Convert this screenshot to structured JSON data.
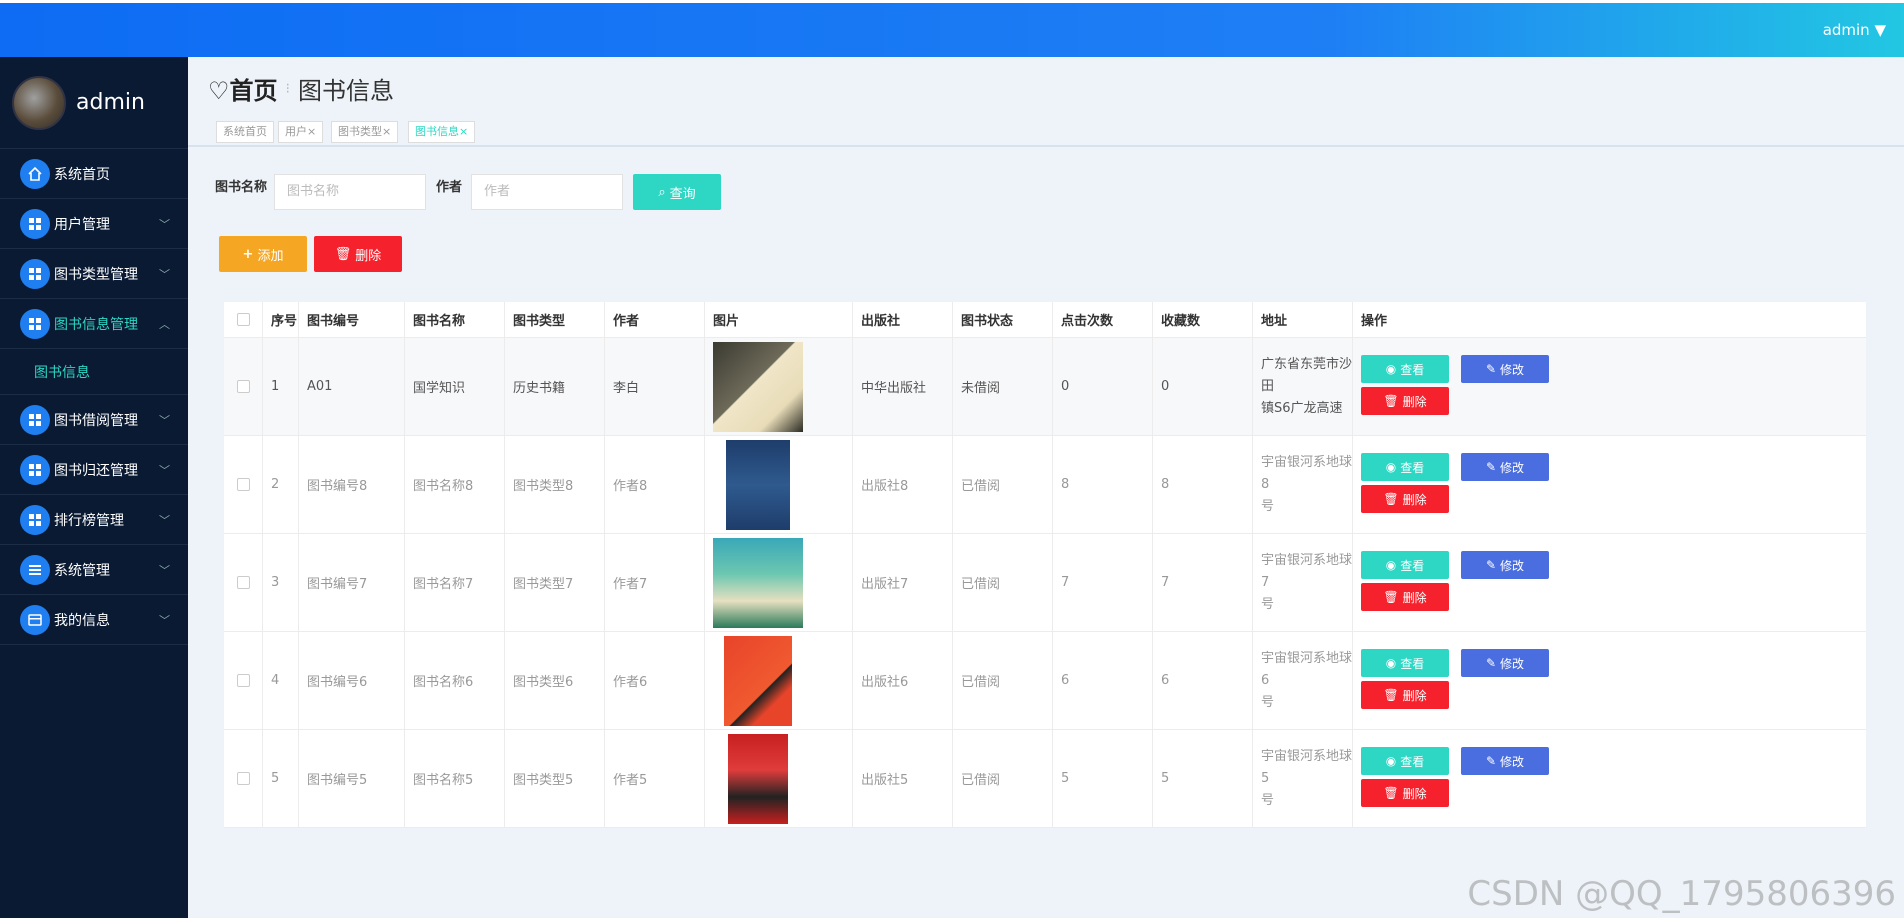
{
  "header": {
    "user": "admin ▼"
  },
  "sidebar": {
    "brand": "admin",
    "items": [
      {
        "label": "系统首页",
        "icon": "home-icon"
      },
      {
        "label": "用户管理",
        "icon": "grid-icon"
      },
      {
        "label": "图书类型管理",
        "icon": "grid-icon"
      },
      {
        "label": "图书信息管理",
        "icon": "grid-icon"
      },
      {
        "label": "图书借阅管理",
        "icon": "grid-icon"
      },
      {
        "label": "图书归还管理",
        "icon": "grid-icon"
      },
      {
        "label": "排行榜管理",
        "icon": "grid-icon"
      },
      {
        "label": "系统管理",
        "icon": "list-icon"
      },
      {
        "label": "我的信息",
        "icon": "card-icon"
      }
    ],
    "sub_item": "图书信息"
  },
  "breadcrumb": {
    "home": "♡首页",
    "current": "图书信息"
  },
  "tags": [
    "系统首页",
    "用户×",
    "图书类型×",
    "图书信息×"
  ],
  "search": {
    "name_label": "图书名称",
    "name_placeholder": "图书名称",
    "author_label": "作者",
    "author_placeholder": "作者",
    "query_btn": "查询"
  },
  "actions": {
    "add": "添加",
    "delete": "删除"
  },
  "table": {
    "headers": [
      "序号",
      "图书编号",
      "图书名称",
      "图书类型",
      "作者",
      "图片",
      "出版社",
      "图书状态",
      "点击次数",
      "收藏数",
      "地址",
      "操作"
    ],
    "rows": [
      {
        "no": "1",
        "code": "A01",
        "name": "国学知识",
        "type": "历史书籍",
        "author": "李白",
        "publisher": "中华出版社",
        "status": "未借阅",
        "clicks": "0",
        "favs": "0",
        "addr1": "广东省东莞市沙田",
        "addr2": "镇S6广龙高速"
      },
      {
        "no": "2",
        "code": "图书编号8",
        "name": "图书名称8",
        "type": "图书类型8",
        "author": "作者8",
        "publisher": "出版社8",
        "status": "已借阅",
        "clicks": "8",
        "favs": "8",
        "addr1": "宇宙银河系地球8",
        "addr2": "号"
      },
      {
        "no": "3",
        "code": "图书编号7",
        "name": "图书名称7",
        "type": "图书类型7",
        "author": "作者7",
        "publisher": "出版社7",
        "status": "已借阅",
        "clicks": "7",
        "favs": "7",
        "addr1": "宇宙银河系地球7",
        "addr2": "号"
      },
      {
        "no": "4",
        "code": "图书编号6",
        "name": "图书名称6",
        "type": "图书类型6",
        "author": "作者6",
        "publisher": "出版社6",
        "status": "已借阅",
        "clicks": "6",
        "favs": "6",
        "addr1": "宇宙银河系地球6",
        "addr2": "号"
      },
      {
        "no": "5",
        "code": "图书编号5",
        "name": "图书名称5",
        "type": "图书类型5",
        "author": "作者5",
        "publisher": "出版社5",
        "status": "已借阅",
        "clicks": "5",
        "favs": "5",
        "addr1": "宇宙银河系地球5",
        "addr2": "号"
      }
    ],
    "row_actions": {
      "view": "查看",
      "edit": "修改",
      "delete": "删除"
    }
  },
  "watermark": "CSDN @QQ_1795806396",
  "colors": {
    "topbar": "#0d6cf3",
    "sidebar": "#0a1a33",
    "accent": "#2ed6c4",
    "add": "#f5a623",
    "danger": "#f5222d",
    "edit": "#4a6ee0"
  }
}
